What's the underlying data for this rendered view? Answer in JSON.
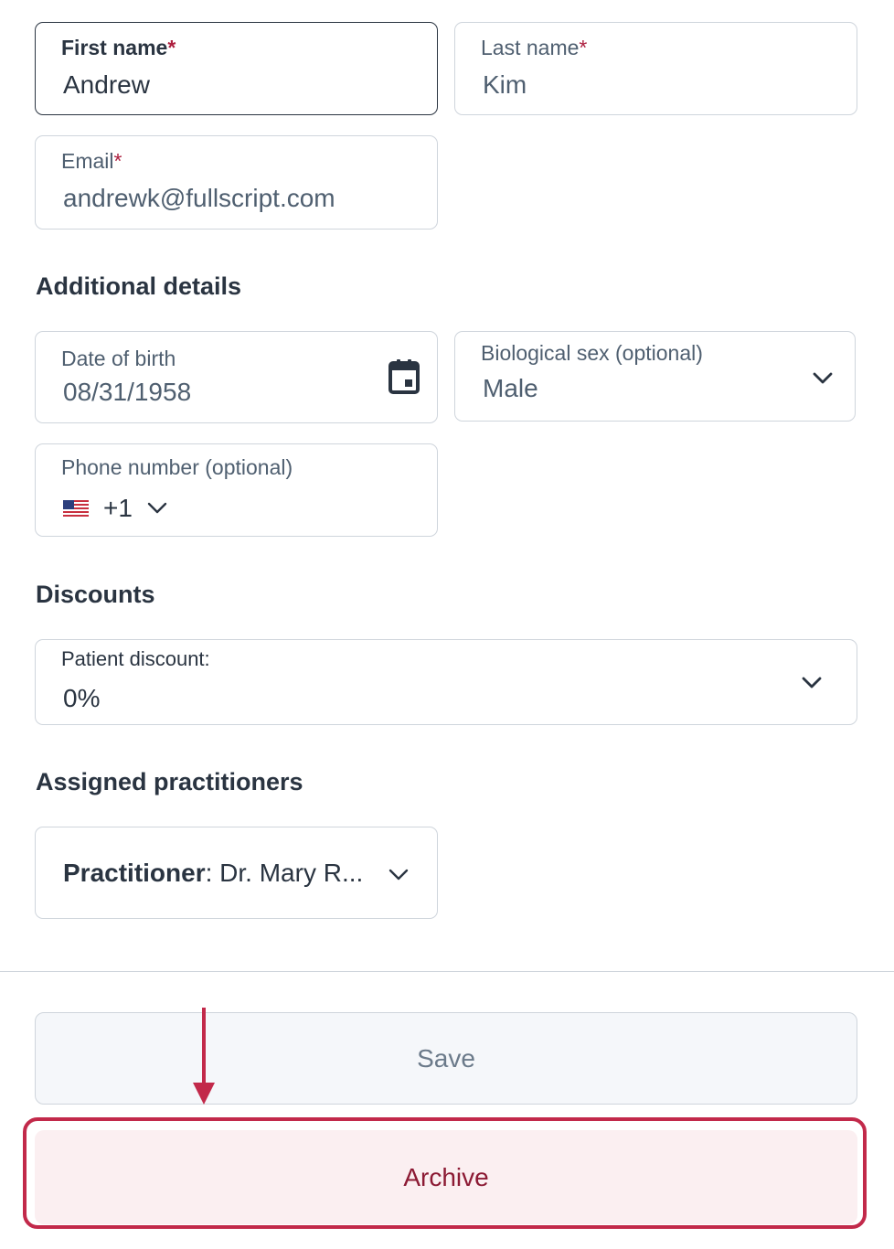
{
  "personal": {
    "first_name": {
      "label": "First name",
      "required_mark": "*",
      "value": "Andrew"
    },
    "last_name": {
      "label": "Last name",
      "required_mark": "*",
      "value": "Kim"
    },
    "email": {
      "label": "Email",
      "required_mark": "*",
      "value": "andrewk@fullscript.com"
    }
  },
  "additional": {
    "title": "Additional details",
    "dob": {
      "label": "Date of birth",
      "value": "08/31/1958",
      "icon": "calendar-icon"
    },
    "sex": {
      "label": "Biological sex (optional)",
      "value": "Male",
      "icon": "chevron-down-icon"
    },
    "phone": {
      "label": "Phone number (optional)",
      "country_code": "+1",
      "flag_icon": "us-flag-icon"
    }
  },
  "discounts": {
    "title": "Discounts",
    "patient_discount": {
      "label": "Patient discount:",
      "value": "0%"
    }
  },
  "practitioners": {
    "title": "Assigned practitioners",
    "practitioner": {
      "label": "Practitioner",
      "separator": ":",
      "value": "Dr. Mary R..."
    }
  },
  "actions": {
    "save_label": "Save",
    "archive_label": "Archive"
  },
  "colors": {
    "accent": "#ad1f3f",
    "highlight": "#c2294a",
    "text_dark": "#2a3441"
  }
}
